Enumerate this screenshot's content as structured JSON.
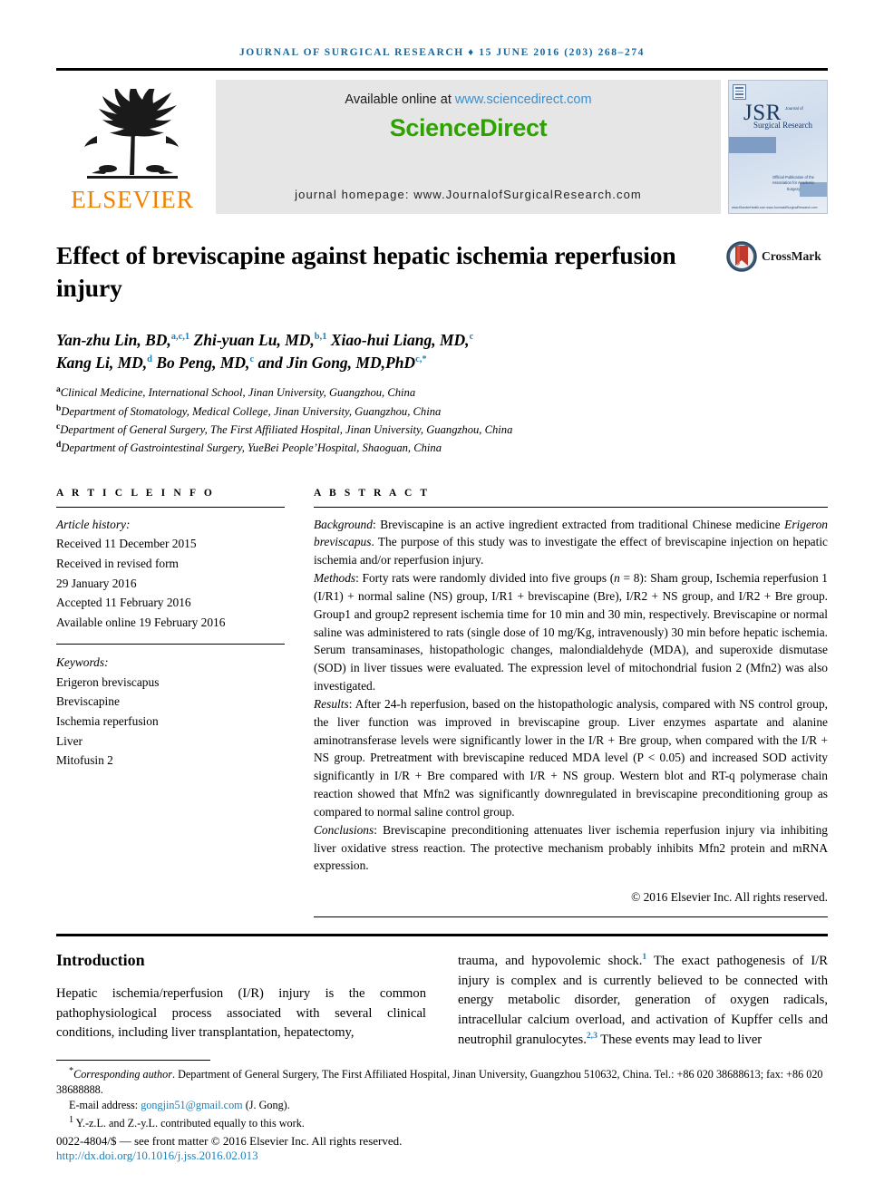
{
  "running_head": "Journal of Surgical Research ♦ 15 June 2016 (203) 268–274",
  "publisher_band": {
    "logo_word": "ELSEVIER",
    "available_prefix": "Available online at ",
    "available_url": "www.sciencedirect.com",
    "sciencedirect_logo": "ScienceDirect",
    "journal_homepage": "journal homepage: www.JournalofSurgicalResearch.com",
    "cover": {
      "acronym": "JSR",
      "sub_line_1": "Journal of",
      "sub_line_2": "Surgical Research",
      "note": "Official Publication of the Association for Academic Surgery",
      "footer": "www.ElsevierHealth.com\nwww.JournalofSurgicalResearch.com"
    }
  },
  "article": {
    "title": "Effect of breviscapine against hepatic ischemia reperfusion injury",
    "crossmark_label": "CrossMark",
    "authors_line_1": "Yan-zhu Lin, BD,",
    "authors_sup_1": "a,c,1",
    "authors_line_1b": " Zhi-yuan Lu, MD,",
    "authors_sup_1b": "b,1",
    "authors_line_1c": " Xiao-hui Liang, MD,",
    "authors_sup_1c": "c",
    "authors_line_2": "Kang Li, MD,",
    "authors_sup_2": "d",
    "authors_line_2b": " Bo Peng, MD,",
    "authors_sup_2b": "c",
    "authors_line_2c": " and Jin Gong, MD,PhD",
    "authors_sup_2c": "c,*",
    "affiliations": [
      {
        "mark": "a",
        "text": "Clinical Medicine, International School, Jinan University, Guangzhou, China"
      },
      {
        "mark": "b",
        "text": "Department of Stomatology, Medical College, Jinan University, Guangzhou, China"
      },
      {
        "mark": "c",
        "text": "Department of General Surgery, The First Affiliated Hospital, Jinan University, Guangzhou, China"
      },
      {
        "mark": "d",
        "text": "Department of Gastrointestinal Surgery, YueBei People’Hospital, Shaoguan, China"
      }
    ]
  },
  "article_info": {
    "heading": "A R T I C L E   I N F O",
    "history_label": "Article history:",
    "history": [
      "Received 11 December 2015",
      "Received in revised form",
      "29 January 2016",
      "Accepted 11 February 2016",
      "Available online 19 February 2016"
    ],
    "keywords_label": "Keywords:",
    "keywords": [
      "Erigeron breviscapus",
      "Breviscapine",
      "Ischemia reperfusion",
      "Liver",
      "Mitofusin 2"
    ]
  },
  "abstract": {
    "heading": "A B S T R A C T",
    "background_label": "Background",
    "background_text_a": ": Breviscapine is an active ingredient extracted from traditional Chinese medicine ",
    "background_italic": "Erigeron breviscapus",
    "background_text_b": ". The purpose of this study was to investigate the effect of breviscapine injection on hepatic ischemia and/or reperfusion injury.",
    "methods_label": "Methods",
    "methods_text_a": ": Forty rats were randomly divided into five groups (",
    "methods_italic": "n",
    "methods_text_b": " = 8): Sham group, Ischemia reperfusion 1 (I/R1) + normal saline (NS) group, I/R1 + breviscapine (Bre), I/R2 + NS group, and I/R2 + Bre group. Group1 and group2 represent ischemia time for 10 min and 30 min, respectively. Breviscapine or normal saline was administered to rats (single dose of 10 mg/Kg, intravenously) 30 min before hepatic ischemia. Serum transaminases, histopathologic changes, malondialdehyde (MDA), and superoxide dismutase (SOD) in liver tissues were evaluated. The expression level of mitochondrial fusion 2 (Mfn2) was also investigated.",
    "results_label": "Results",
    "results_text": ": After 24-h reperfusion, based on the histopathologic analysis, compared with NS control group, the liver function was improved in breviscapine group. Liver enzymes aspartate and alanine aminotransferase levels were significantly lower in the I/R + Bre group, when compared with the I/R + NS group. Pretreatment with breviscapine reduced MDA level (P < 0.05) and increased SOD activity significantly in I/R + Bre compared with I/R + NS group. Western blot and RT-q polymerase chain reaction showed that Mfn2 was significantly downregulated in breviscapine preconditioning group as compared to normal saline control group.",
    "conclusions_label": "Conclusions",
    "conclusions_text": ": Breviscapine preconditioning attenuates liver ischemia reperfusion injury via inhibiting liver oxidative stress reaction. The protective mechanism probably inhibits Mfn2 protein and mRNA expression.",
    "copyright": "© 2016 Elsevier Inc. All rights reserved."
  },
  "body": {
    "intro_heading": "Introduction",
    "intro_left": "Hepatic ischemia/reperfusion (I/R) injury is the common pathophysiological process associated with several clinical conditions, including liver transplantation, hepatectomy,",
    "intro_right_a": "trauma, and hypovolemic shock.",
    "intro_right_sup1": "1",
    "intro_right_b": " The exact pathogenesis of I/R injury is complex and is currently believed to be connected with energy metabolic disorder, generation of oxygen radicals, intracellular calcium overload, and activation of Kupffer cells and neutrophil granulocytes.",
    "intro_right_sup2": "2,3",
    "intro_right_c": " These events may lead to liver"
  },
  "footnotes": {
    "corresponding_mark": "*",
    "corresponding_label": "Corresponding author",
    "corresponding_text": ". Department of General Surgery, The First Affiliated Hospital, Jinan University, Guangzhou 510632, China. Tel.: +86 020 38688613; fax: +86 020 38688888.",
    "email_label": "E-mail address: ",
    "email_link": "gongjin51@gmail.com",
    "email_suffix": " (J. Gong).",
    "equal_mark": "1",
    "equal_text": " Y.-z.L. and Z.-y.L. contributed equally to this work.",
    "issn_line": "0022-4804/$ — see front matter © 2016 Elsevier Inc. All rights reserved.",
    "doi_line": "http://dx.doi.org/10.1016/j.jss.2016.02.013"
  },
  "colors": {
    "header_blue": "#16679c",
    "link_blue": "#1f7fb8",
    "sciencedirect_green": "#2ea300",
    "elsevier_orange": "#f08000",
    "band_gray": "#e6e6e6"
  }
}
